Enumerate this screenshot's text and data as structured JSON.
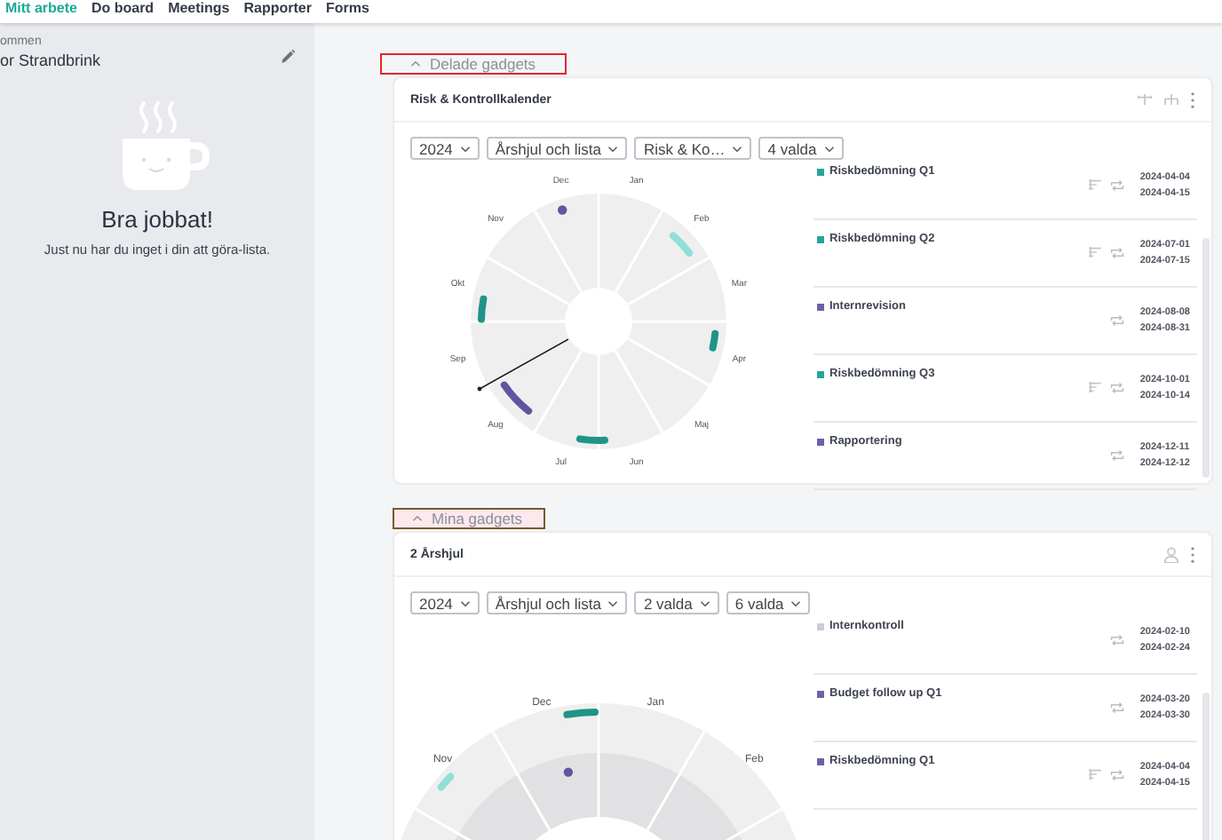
{
  "nav": {
    "items": [
      {
        "label": "Mitt arbete",
        "selected": true
      },
      {
        "label": "Do board",
        "selected": false
      },
      {
        "label": "Meetings",
        "selected": false
      },
      {
        "label": "Rapporter",
        "selected": false
      },
      {
        "label": "Forms",
        "selected": false
      }
    ]
  },
  "sidebar": {
    "greeting": "ommen",
    "name": "or Strandbrink",
    "empty_title": "Bra jobbat!",
    "empty_text": "Just nu har du inget i din att göra-lista."
  },
  "sections": [
    {
      "title": "Delade gadgets",
      "expanded": true,
      "color": "#e3262d",
      "highlighted": false,
      "cards": [
        {
          "title": "Risk & Kontrollkalender",
          "kind": "compact",
          "filters": [
            "2024",
            "Årshjul och lista",
            "Risk & Ko…",
            "4 valda"
          ],
          "months": [
            "Jan",
            "Feb",
            "Mar",
            "Apr",
            "Maj",
            "Jun",
            "Jul",
            "Aug",
            "Sep",
            "Okt",
            "Nov",
            "Dec"
          ],
          "events": [
            {
              "title": "Riskbedömning Q1",
              "color": "#26a69a",
              "has_checklist": true,
              "dates": [
                "2024-04-04",
                "2024-04-15"
              ]
            },
            {
              "title": "Riskbedömning Q2",
              "color": "#26a69a",
              "has_checklist": true,
              "dates": [
                "2024-07-01",
                "2024-07-15"
              ]
            },
            {
              "title": "Internrevision",
              "color": "#6a62a8",
              "has_checklist": false,
              "dates": [
                "2024-08-08",
                "2024-08-31"
              ]
            },
            {
              "title": "Riskbedömning Q3",
              "color": "#26a69a",
              "has_checklist": true,
              "dates": [
                "2024-10-01",
                "2024-10-14"
              ]
            },
            {
              "title": "Rapportering",
              "color": "#6a62a8",
              "has_checklist": false,
              "dates": [
                "2024-12-11",
                "2024-12-12"
              ]
            }
          ]
        }
      ]
    },
    {
      "title": "Mina gadgets",
      "expanded": true,
      "color": "#7a5a2a",
      "highlighted": true,
      "cards": [
        {
          "title": "2 Årshjul",
          "kind": "large",
          "filters": [
            "2024",
            "Årshjul och lista",
            "2 valda",
            "6 valda"
          ],
          "months": [
            "Nov",
            "Dec",
            "Jan",
            "Feb"
          ],
          "events": [
            {
              "title": "Internkontroll",
              "color": "#c9ced8",
              "has_checklist": false,
              "dates": [
                "2024-02-10",
                "2024-02-24"
              ]
            },
            {
              "title": "Budget follow up Q1",
              "color": "#6a62a8",
              "has_checklist": false,
              "dates": [
                "2024-03-20",
                "2024-03-30"
              ]
            },
            {
              "title": "Riskbedömning Q1",
              "color": "#6a62a8",
              "has_checklist": true,
              "dates": [
                "2024-04-04",
                "2024-04-15"
              ]
            }
          ]
        }
      ]
    }
  ]
}
